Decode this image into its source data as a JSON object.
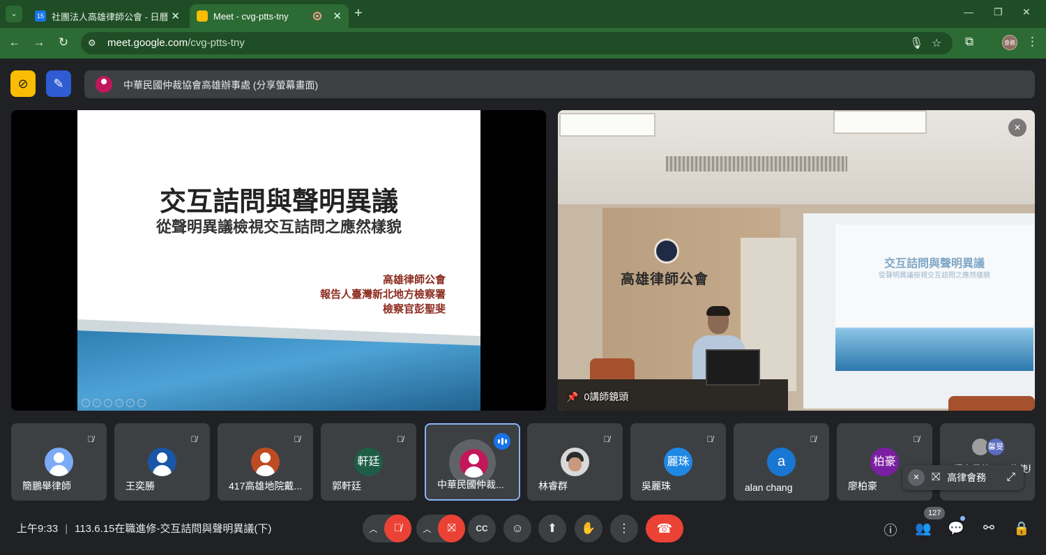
{
  "browser": {
    "tabs": [
      {
        "title": "社團法人高雄律師公會 - 日曆 -",
        "favicon": "calendar-favicon",
        "favicon_text": "15"
      },
      {
        "title": "Meet - cvg-ptts-tny",
        "favicon": "meet-favicon",
        "active": true
      }
    ],
    "new_tab": "+",
    "address": {
      "host": "meet.google.com",
      "path": "/cvg-ptts-tny"
    },
    "profile_text": "會務",
    "colors": {
      "frame": "#1f4d25",
      "toolbar": "#2d6b34"
    }
  },
  "meet": {
    "presenter_label": "中華民國仲裁協會高雄辦事處 (分享螢幕畫面)",
    "slide": {
      "title": "交互詰問與聲明異議",
      "subtitle": "從聲明異議檢視交互詰問之應然樣貌",
      "author_lines": [
        "高雄律師公會",
        "報告人臺灣新北地方檢察署",
        "檢察官彭聖斐"
      ]
    },
    "camera": {
      "label": "0講師鏡頭",
      "wall_sign": "高雄律師公會",
      "projected_title": "交互詰問與聲明異議",
      "projected_subtitle": "從聲明異議檢視交互詰問之應然樣貌"
    },
    "participants": [
      {
        "name": "簡鵬舉律師",
        "avatar_color": "#7baaf7",
        "avatar_text": "",
        "muted": true
      },
      {
        "name": "王奕勝",
        "avatar_color": "#1a56a8",
        "avatar_text": "",
        "muted": true
      },
      {
        "name": "417高雄地院戴...",
        "avatar_color": "#bf4b22",
        "avatar_text": "",
        "muted": true
      },
      {
        "name": "郭軒廷",
        "avatar_color": "#1e5e46",
        "avatar_text": "軒廷",
        "muted": true
      },
      {
        "name": "中華民國仲裁...",
        "avatar_color": "#c2185b",
        "avatar_text": "",
        "speaking": true
      },
      {
        "name": "林睿群",
        "avatar_color": "#e0e0e0",
        "avatar_text": "",
        "muted": true
      },
      {
        "name": "吳麗珠",
        "avatar_color": "#1e88e5",
        "avatar_text": "麗珠",
        "muted": true
      },
      {
        "name": "alan chang",
        "avatar_color": "#1976d2",
        "avatar_text": "a",
        "muted": true
      },
      {
        "name": "廖柏豪",
        "avatar_color": "#7b1fa2",
        "avatar_text": "柏豪",
        "muted": true
      }
    ],
    "more_tile": {
      "text": "還有另外 117 位使用",
      "avatar_text": "馨旻"
    },
    "self_view": {
      "name": "高律會務"
    },
    "bottom": {
      "time": "上午9:33",
      "meeting_title": "113.6.15在職進修-交互詰問與聲明異議(下)",
      "participant_count": "127"
    }
  }
}
